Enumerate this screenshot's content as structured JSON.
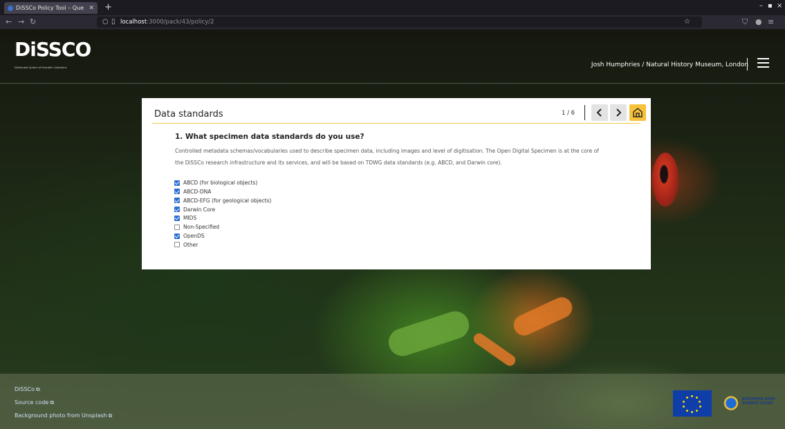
{
  "browser": {
    "tab_title": "DiSSCo Policy Tool – Que",
    "new_tab": "+",
    "url_host": "localhost",
    "url_path": ":3000/pack/43/policy/2"
  },
  "header": {
    "logo_text": "DiSSCO",
    "logo_subtitle": "Distributed System of Scientific Collections",
    "user": "Josh Humphries / Natural History Museum, London"
  },
  "card": {
    "title": "Data standards",
    "progress": "1 / 6",
    "question": "1. What specimen data standards do you use?",
    "description_line1": "Controlled metadata schemas/vocabularies used to describe specimen data, including images and level of digitisation. The Open Digital Specimen is at the core of",
    "description_line2": "the DiSSCo research infrastructure and its services, and will be based on TDWG data standards (e.g. ABCD, and Darwin core).",
    "options": [
      {
        "label": "ABCD (for biological objects)",
        "checked": true
      },
      {
        "label": "ABCD-DNA",
        "checked": true
      },
      {
        "label": "ABCD-EFG (for geological objects)",
        "checked": true
      },
      {
        "label": "Darwin Core",
        "checked": true
      },
      {
        "label": "MIDS",
        "checked": true
      },
      {
        "label": "Non-Specified",
        "checked": false
      },
      {
        "label": "OpenDS",
        "checked": true
      },
      {
        "label": "Other",
        "checked": false
      }
    ]
  },
  "footer": {
    "links": [
      "DiSSCo",
      "Source code",
      "Background photo from Unsplash"
    ],
    "eosc_line1": "EUROPEAN OPEN",
    "eosc_line2": "SCIENCE CLOUD"
  },
  "colors": {
    "accent": "#f7c23b",
    "checkbox": "#2a6fd4"
  }
}
